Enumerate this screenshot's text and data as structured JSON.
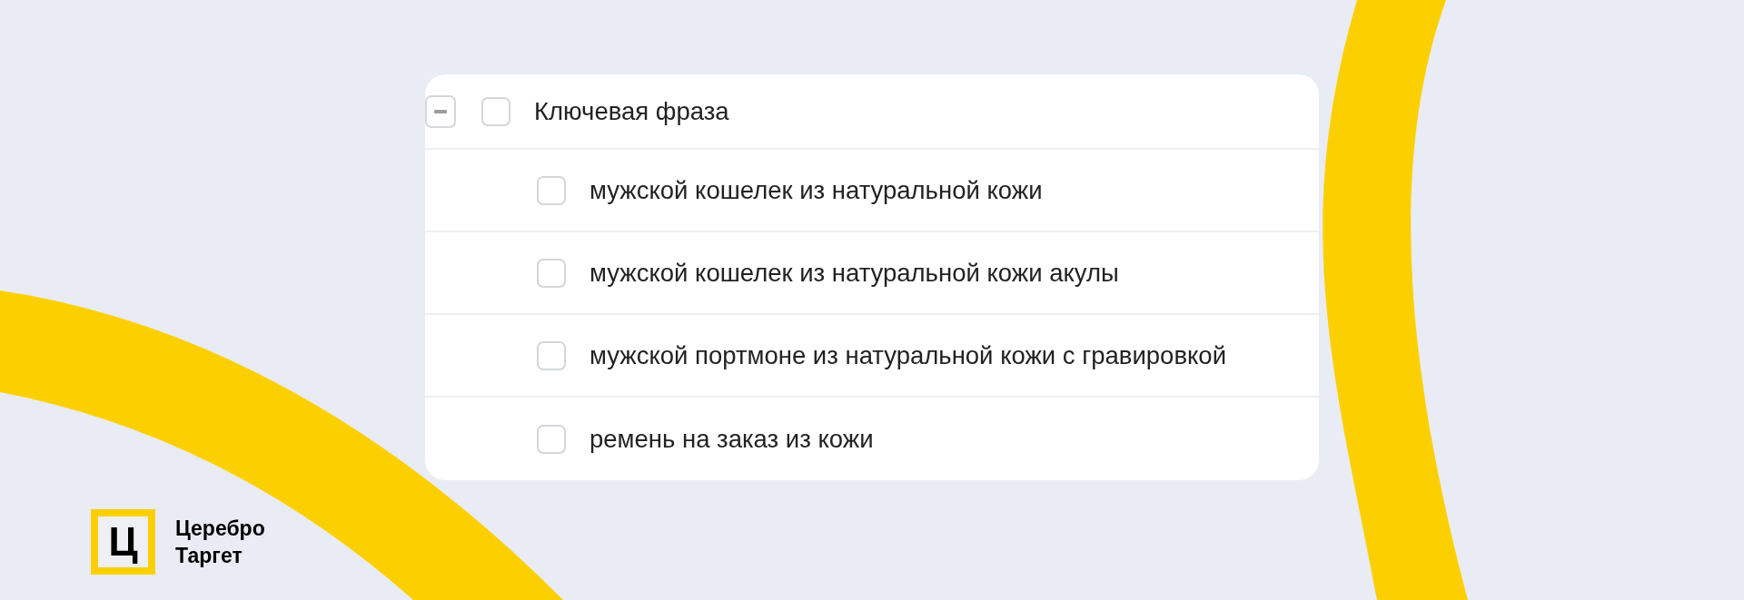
{
  "table": {
    "header": {
      "expanded": true,
      "checked": false,
      "label": "Ключевая фраза"
    },
    "rows": [
      {
        "checked": false,
        "text": "мужской кошелек из натуральной кожи"
      },
      {
        "checked": false,
        "text": "мужской кошелек из натуральной кожи акулы"
      },
      {
        "checked": false,
        "text": "мужской портмоне из натуральной кожи с гравировкой"
      },
      {
        "checked": false,
        "text": "ремень на заказ из кожи"
      }
    ]
  },
  "logo": {
    "mark": "Ц",
    "lines": [
      "Церебро",
      "Таргет"
    ]
  }
}
